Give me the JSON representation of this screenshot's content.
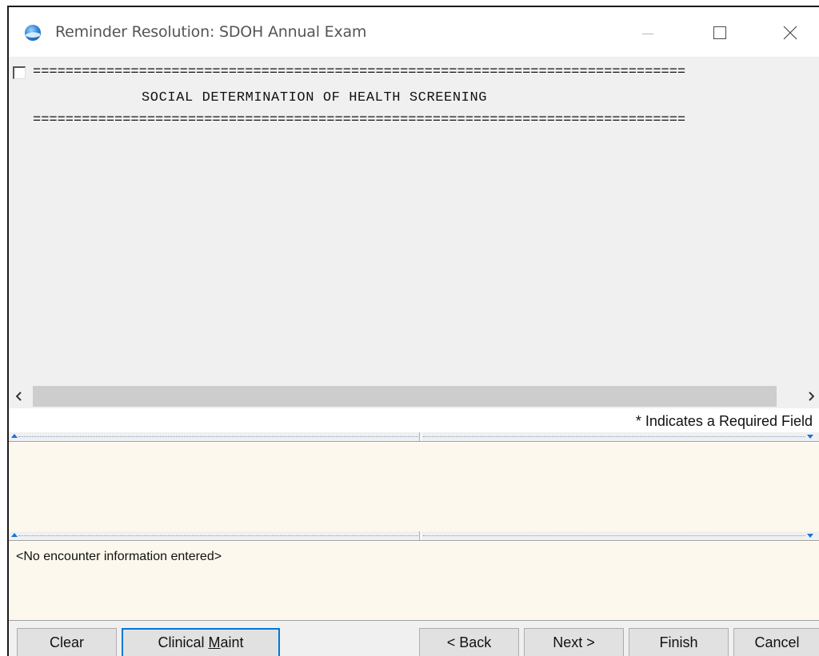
{
  "window": {
    "title": "Reminder Resolution: SDOH Annual Exam"
  },
  "content": {
    "separator": "================================================================================",
    "header": "SOCIAL DETERMINATION OF HEALTH SCREENING",
    "checkbox_checked": false
  },
  "required_note": "* Indicates a Required Field",
  "panels": {
    "encounter_text": "<No encounter information entered>"
  },
  "buttons": {
    "clear": "Clear",
    "clinical_maint_prefix": "Clinical ",
    "clinical_maint_mnemonic": "M",
    "clinical_maint_suffix": "aint",
    "back": "< Back",
    "next": "Next >",
    "finish": "Finish",
    "cancel": "Cancel"
  }
}
